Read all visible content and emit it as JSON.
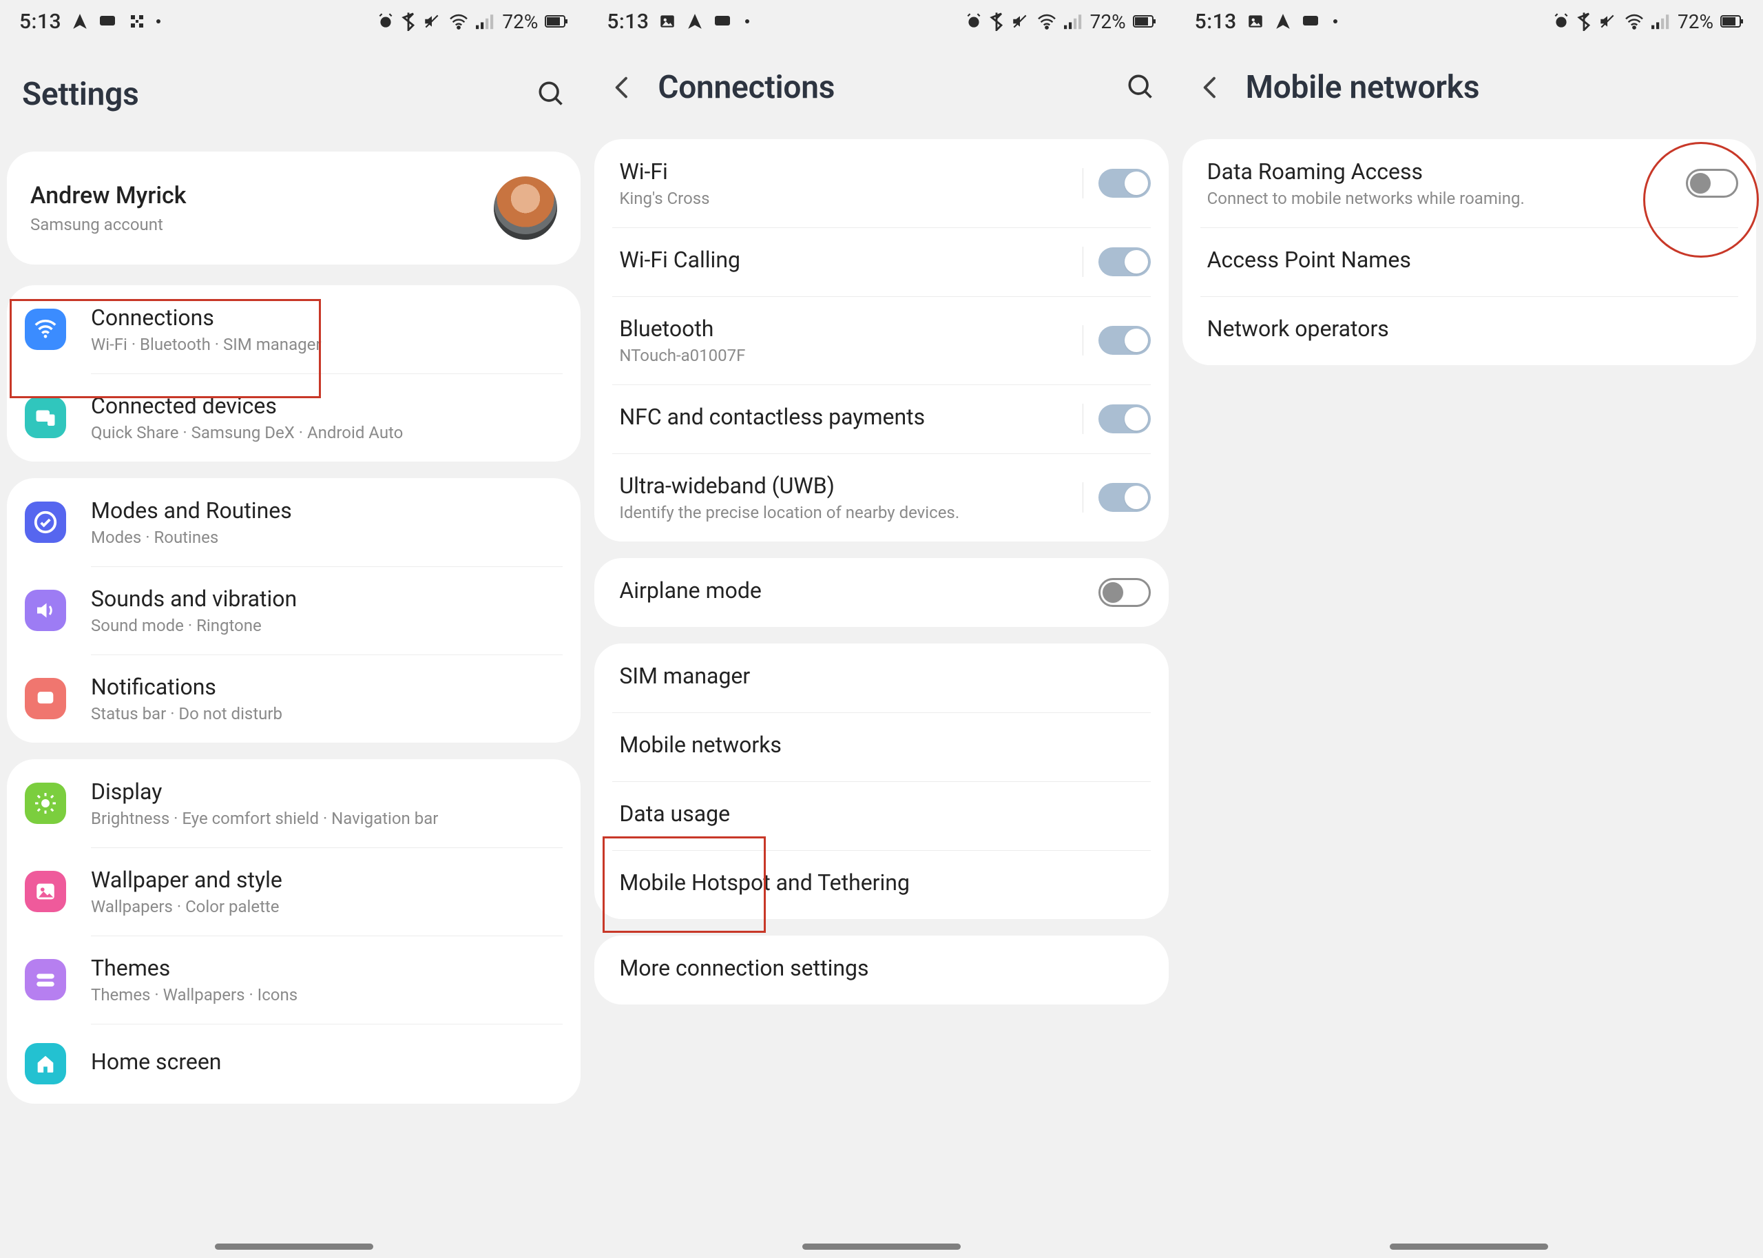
{
  "status": {
    "time": "5:13",
    "battery": "72%"
  },
  "phone1": {
    "title": "Settings",
    "account": {
      "name": "Andrew Myrick",
      "sub": "Samsung account"
    },
    "groups": [
      [
        {
          "title": "Connections",
          "sub": "Wi-Fi  ·  Bluetooth  ·  SIM manager",
          "iconColor": "#3b8cff",
          "icon": "wifi",
          "highlight": true
        },
        {
          "title": "Connected devices",
          "sub": "Quick Share  ·  Samsung DeX  ·  Android Auto",
          "iconColor": "#30c6bd",
          "icon": "devices"
        }
      ],
      [
        {
          "title": "Modes and Routines",
          "sub": "Modes  ·  Routines",
          "iconColor": "#5666ef",
          "icon": "check"
        },
        {
          "title": "Sounds and vibration",
          "sub": "Sound mode  ·  Ringtone",
          "iconColor": "#9d7cf4",
          "icon": "sound"
        },
        {
          "title": "Notifications",
          "sub": "Status bar  ·  Do not disturb",
          "iconColor": "#f0766f",
          "icon": "notif"
        }
      ],
      [
        {
          "title": "Display",
          "sub": "Brightness  ·  Eye comfort shield  ·  Navigation bar",
          "iconColor": "#7bce3e",
          "icon": "sun"
        },
        {
          "title": "Wallpaper and style",
          "sub": "Wallpapers  ·  Color palette",
          "iconColor": "#ef5a9b",
          "icon": "image"
        },
        {
          "title": "Themes",
          "sub": "Themes  ·  Wallpapers  ·  Icons",
          "iconColor": "#b67ff0",
          "icon": "theme"
        },
        {
          "title": "Home screen",
          "sub": "",
          "iconColor": "#23c1d1",
          "icon": "home"
        }
      ]
    ]
  },
  "phone2": {
    "title": "Connections",
    "groups": [
      [
        {
          "title": "Wi-Fi",
          "sub": "King's Cross",
          "toggle": "on",
          "sep": true
        },
        {
          "title": "Wi-Fi Calling",
          "sub": "",
          "toggle": "on",
          "sep": true
        },
        {
          "title": "Bluetooth",
          "sub": "NTouch-a01007F",
          "toggle": "on",
          "sep": true
        },
        {
          "title": "NFC and contactless payments",
          "sub": "",
          "toggle": "on",
          "sep": true
        },
        {
          "title": "Ultra-wideband (UWB)",
          "sub": "Identify the precise location of nearby devices.",
          "toggle": "on",
          "sep": true
        }
      ],
      [
        {
          "title": "Airplane mode",
          "sub": "",
          "toggle": "off"
        }
      ],
      [
        {
          "title": "SIM manager",
          "sub": ""
        },
        {
          "title": "Mobile networks",
          "sub": "",
          "highlight": true
        },
        {
          "title": "Data usage",
          "sub": ""
        },
        {
          "title": "Mobile Hotspot and Tethering",
          "sub": ""
        }
      ],
      [
        {
          "title": "More connection settings",
          "sub": ""
        }
      ]
    ]
  },
  "phone3": {
    "title": "Mobile networks",
    "groups": [
      [
        {
          "title": "Data Roaming Access",
          "sub": "Connect to mobile networks while roaming.",
          "toggle": "off",
          "highlightCircle": true
        },
        {
          "title": "Access Point Names",
          "sub": ""
        },
        {
          "title": "Network operators",
          "sub": ""
        }
      ]
    ]
  }
}
